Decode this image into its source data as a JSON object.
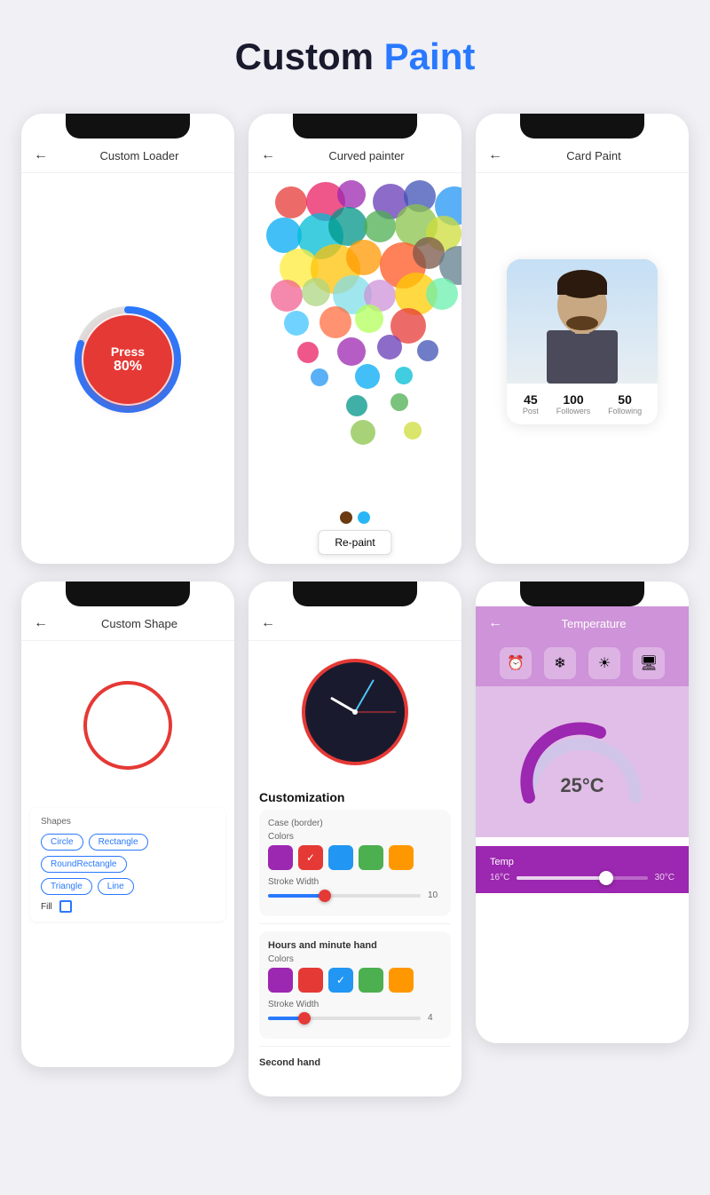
{
  "page": {
    "title_plain": "Custom",
    "title_accent": "Paint"
  },
  "row1": {
    "loader": {
      "header_title": "Custom Loader",
      "press_label": "Press",
      "percent_label": "80%"
    },
    "curved_painter": {
      "header_title": "Curved painter",
      "repaint_label": "Re-paint"
    },
    "card_paint": {
      "header_title": "Card Paint",
      "stat1_num": "45",
      "stat1_label": "Post",
      "stat2_num": "100",
      "stat2_label": "Followers",
      "stat3_num": "50",
      "stat3_label": "Following"
    }
  },
  "row2": {
    "custom_shape": {
      "header_title": "Custom Shape",
      "shapes_section_label": "Shapes",
      "btn1": "Circle",
      "btn2": "Rectangle",
      "btn3": "RoundRectangle",
      "btn4": "Triangle",
      "btn5": "Line",
      "fill_label": "Fill"
    },
    "clock": {
      "header_title": "Customization",
      "section_case": "Case (border)",
      "colors_label": "Colors",
      "stroke_label": "Stroke Width",
      "stroke_value1": "10",
      "hours_section": "Hours and minute hand",
      "stroke_value2": "4",
      "second_section": "Second hand"
    },
    "temperature": {
      "header_title": "Temperature",
      "temp_value": "25°C",
      "slider_label": "Temp",
      "min_temp": "16°C",
      "max_temp": "30°C"
    }
  }
}
